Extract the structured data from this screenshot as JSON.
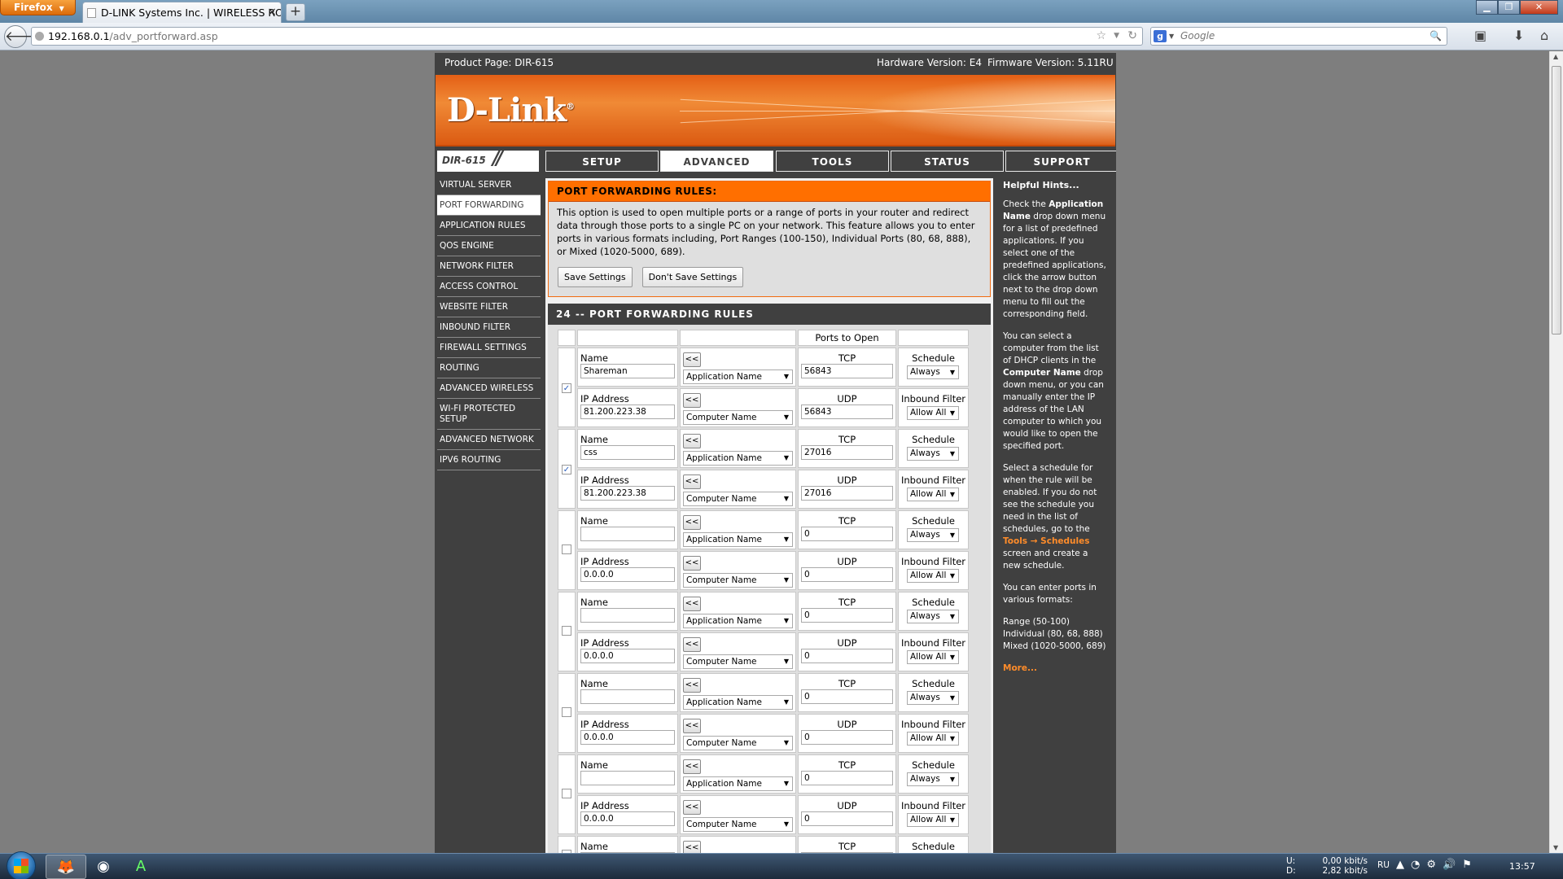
{
  "browser": {
    "menu_label": "Firefox",
    "tab_title": "D-LINK Systems Inc. | WIRELESS ROUTER...",
    "url_main": "192.168.0.1",
    "url_path": "/adv_portforward.asp",
    "search_engine": "Google"
  },
  "router": {
    "product_page": "Product Page: DIR-615",
    "hardware": "Hardware Version: E4",
    "firmware": "Firmware Version: 5.11RU",
    "logo": "D-Link",
    "model": "DIR-615",
    "tabs": [
      "SETUP",
      "ADVANCED",
      "TOOLS",
      "STATUS",
      "SUPPORT"
    ],
    "active_tab": "ADVANCED",
    "sidebar": [
      "VIRTUAL SERVER",
      "PORT FORWARDING",
      "APPLICATION RULES",
      "QOS ENGINE",
      "NETWORK FILTER",
      "ACCESS CONTROL",
      "WEBSITE FILTER",
      "INBOUND FILTER",
      "FIREWALL SETTINGS",
      "ROUTING",
      "ADVANCED WIRELESS",
      "WI-FI PROTECTED SETUP",
      "ADVANCED NETWORK",
      "IPV6 ROUTING"
    ],
    "active_sidebar": "PORT FORWARDING"
  },
  "intro": {
    "title": "PORT FORWARDING RULES:",
    "text": "This option is used to open multiple ports or a range of ports in your router and redirect data through those ports to a single PC on your network. This feature allows you to enter ports in various formats including, Port Ranges (100-150), Individual Ports (80, 68, 888), or Mixed (1020-5000, 689).",
    "save": "Save Settings",
    "dont_save": "Don't Save Settings"
  },
  "rules": {
    "title": "24 -- PORT FORWARDING RULES",
    "ports_header": "Ports to Open",
    "labels": {
      "name": "Name",
      "ip": "IP Address",
      "arrow": "<<",
      "app_name": "Application Name",
      "comp_name": "Computer Name",
      "tcp": "TCP",
      "udp": "UDP",
      "schedule": "Schedule",
      "inbound": "Inbound Filter"
    },
    "rows": [
      {
        "checked": true,
        "name": "Shareman",
        "ip": "81.200.223.38",
        "tcp": "56843",
        "udp": "56843",
        "schedule": "Always",
        "filter": "Allow All"
      },
      {
        "checked": true,
        "name": "css",
        "ip": "81.200.223.38",
        "tcp": "27016",
        "udp": "27016",
        "schedule": "Always",
        "filter": "Allow All"
      },
      {
        "checked": false,
        "name": "",
        "ip": "0.0.0.0",
        "tcp": "0",
        "udp": "0",
        "schedule": "Always",
        "filter": "Allow All"
      },
      {
        "checked": false,
        "name": "",
        "ip": "0.0.0.0",
        "tcp": "0",
        "udp": "0",
        "schedule": "Always",
        "filter": "Allow All"
      },
      {
        "checked": false,
        "name": "",
        "ip": "0.0.0.0",
        "tcp": "0",
        "udp": "0",
        "schedule": "Always",
        "filter": "Allow All"
      },
      {
        "checked": false,
        "name": "",
        "ip": "0.0.0.0",
        "tcp": "0",
        "udp": "0",
        "schedule": "Always",
        "filter": "Allow All"
      },
      {
        "checked": false,
        "name": "",
        "ip": "",
        "tcp": "",
        "udp": "",
        "schedule": "",
        "filter": ""
      }
    ]
  },
  "hints": {
    "title": "Helpful Hints...",
    "p1_a": "Check the ",
    "p1_b": "Application Name",
    "p1_c": " drop down menu for a list of predefined applications. If you select one of the predefined applications, click the arrow button next to the drop down menu to fill out the corresponding field.",
    "p2_a": "You can select a computer from the list of DHCP clients in the ",
    "p2_b": "Computer Name",
    "p2_c": " drop down menu, or you can manually enter the IP address of the LAN computer to which you would like to open the specified port.",
    "p3_a": "Select a schedule for when the rule will be enabled. If you do not see the schedule you need in the list of schedules, go to the ",
    "p3_b": "Tools → Schedules",
    "p3_c": " screen and create a new schedule.",
    "p4": "You can enter ports in various formats:",
    "p5": "Range (50-100) Individual (80, 68, 888) Mixed (1020-5000, 689)",
    "more": "More..."
  },
  "taskbar": {
    "up_label": "U:",
    "down_label": "D:",
    "up_speed": "0,00 kbit/s",
    "down_speed": "2,82 kbit/s",
    "lang": "RU",
    "time": "13:57"
  }
}
